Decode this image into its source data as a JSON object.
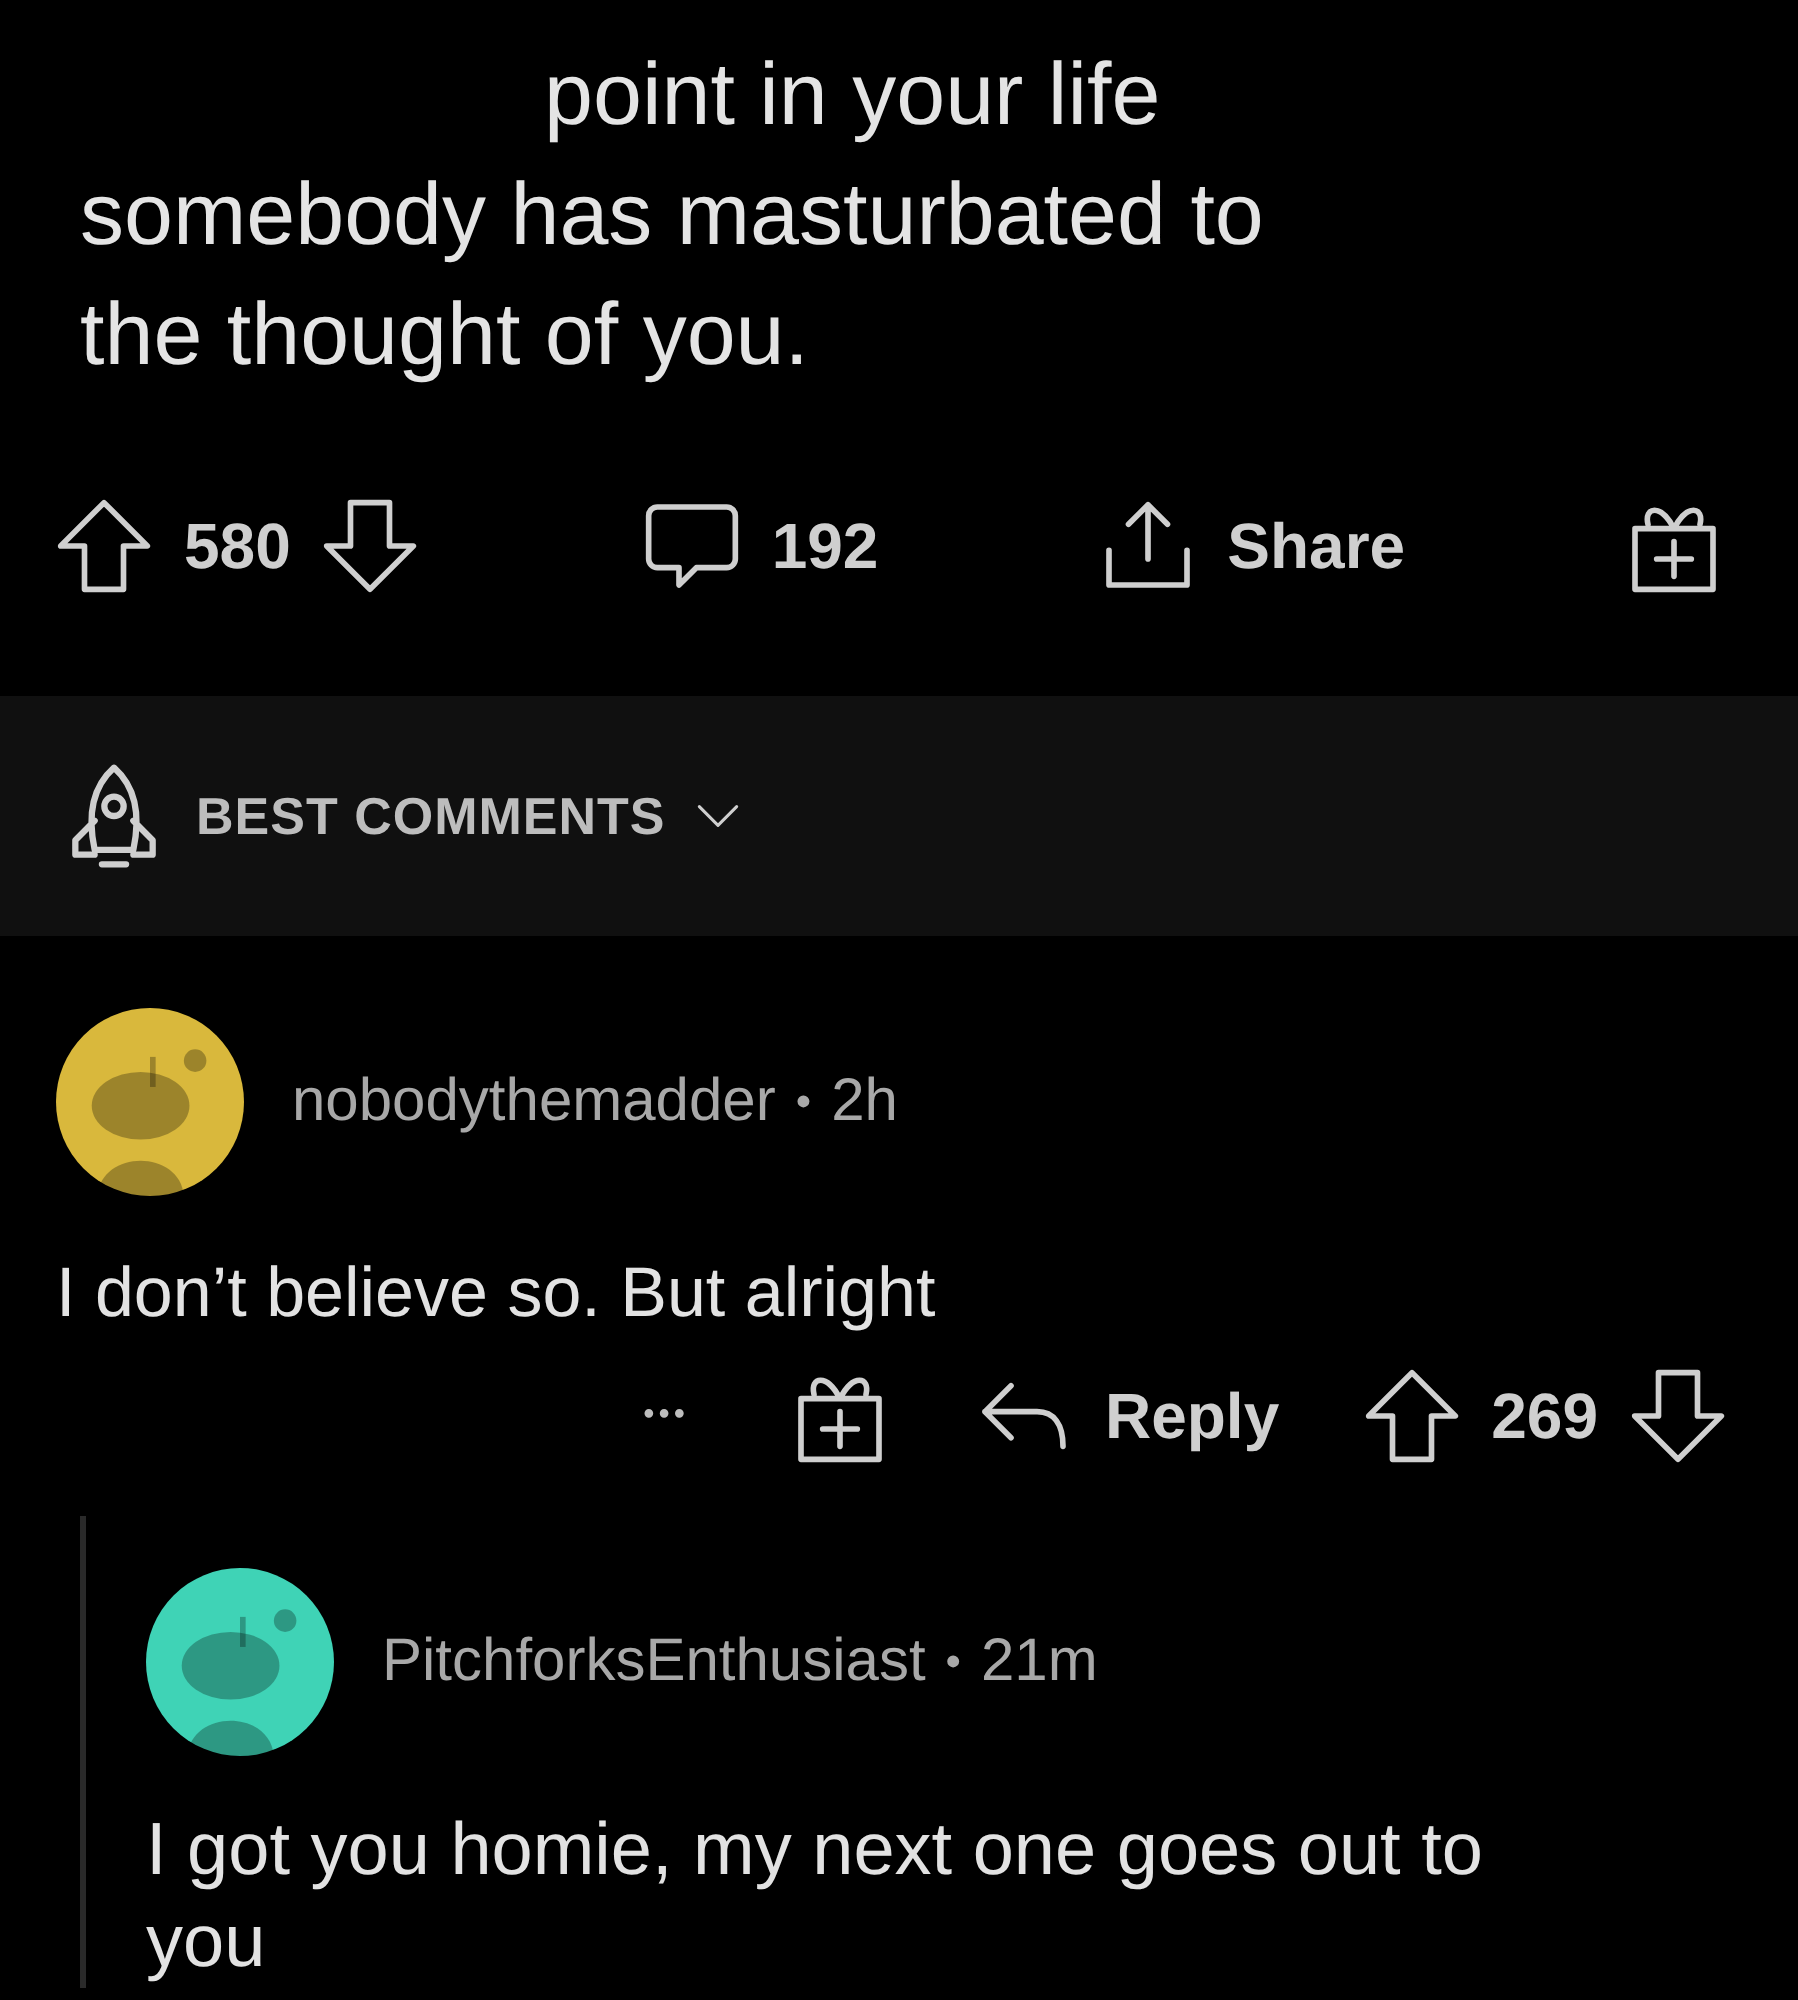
{
  "post": {
    "title": "point in your life somebody has masturbated to the thought of you.",
    "score": "580",
    "comments": "192",
    "share": "Share"
  },
  "sort": {
    "label": "BEST COMMENTS"
  },
  "comments": [
    {
      "author": "nobodythemadder",
      "separator": "•",
      "age": "2h",
      "color": "#d9b83c",
      "body": "I don’t believe so. But alright",
      "more": "•••",
      "reply": "Reply",
      "score": "269",
      "children": [
        {
          "author": "PitchforksEnthusiast",
          "separator": "•",
          "age": "21m",
          "color": "#3fd3b6",
          "body": "I got you homie, my next one goes out to you"
        }
      ]
    }
  ]
}
